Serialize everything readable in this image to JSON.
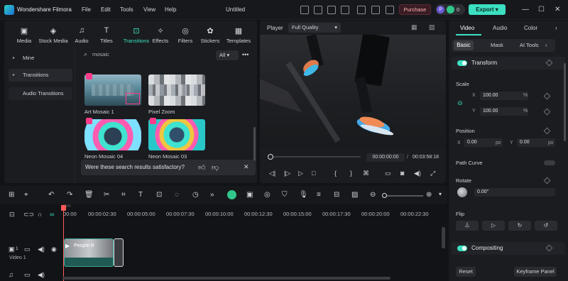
{
  "app": {
    "name": "Wondershare Filmora",
    "menu": [
      "File",
      "Edit",
      "Tools",
      "View",
      "Help"
    ],
    "project_title": "Untitled",
    "purchase_label": "Purchase",
    "credit_initial": "P",
    "credit_count": "0",
    "export_label": "Export"
  },
  "media_tabs": [
    {
      "label": "Media",
      "icon": "media-icon"
    },
    {
      "label": "Stock Media",
      "icon": "stock-media-icon"
    },
    {
      "label": "Audio",
      "icon": "music-note-icon"
    },
    {
      "label": "Titles",
      "icon": "text-icon"
    },
    {
      "label": "Transitions",
      "icon": "transitions-icon"
    },
    {
      "label": "Effects",
      "icon": "effects-icon"
    },
    {
      "label": "Filters",
      "icon": "filters-icon"
    },
    {
      "label": "Stickers",
      "icon": "stickers-icon"
    },
    {
      "label": "Templates",
      "icon": "templates-icon"
    }
  ],
  "left_nav": [
    "Mine",
    "Transitions",
    "Audio Transitions"
  ],
  "search": {
    "query": "mosaic",
    "filter": "All"
  },
  "results": [
    {
      "label": "Art Mosaic 1"
    },
    {
      "label": "Pixel Zoom"
    },
    {
      "label": "Neon Mosaic 04"
    },
    {
      "label": "Neon Mosaic 03"
    }
  ],
  "feedback_prompt": "Were these search results satisfactory?",
  "player": {
    "label": "Player",
    "quality": "Full Quality",
    "current_time": "00:00:00:00",
    "separator": "/",
    "total_time": "00:03:58:18"
  },
  "props": {
    "tabs": [
      "Video",
      "Audio",
      "Color"
    ],
    "subtabs": [
      "Basic",
      "Mask",
      "AI Tools"
    ],
    "transform_title": "Transform",
    "scale_label": "Scale",
    "scale_x": "100.00",
    "scale_y": "100.00",
    "percent": "%",
    "x_label": "X",
    "y_label": "Y",
    "position_label": "Position",
    "pos_x": "0.00",
    "pos_y": "0.00",
    "px_unit": "px",
    "path_curve_label": "Path Curve",
    "rotate_label": "Rotate",
    "rotate_value": "0.00°",
    "flip_label": "Flip",
    "compositing_title": "Compositing",
    "reset_label": "Reset",
    "keyframe_panel_label": "Keyframe Panel"
  },
  "timeline": {
    "ticks": [
      "00:00",
      "00:00:02:30",
      "00:00:05:00",
      "00:00:07:30",
      "00:00:10:00",
      "00:00:12:30",
      "00:00:15:00",
      "00:00:17:30",
      "00:00:20:00",
      "00:00:22:30"
    ],
    "clip_name": "People R",
    "track_label": "Video 1",
    "track_number": "1"
  },
  "colors": {
    "accent": "#3be0c0",
    "playhead": "#ff5a5a",
    "pink_tag": "#ff3b8a"
  }
}
